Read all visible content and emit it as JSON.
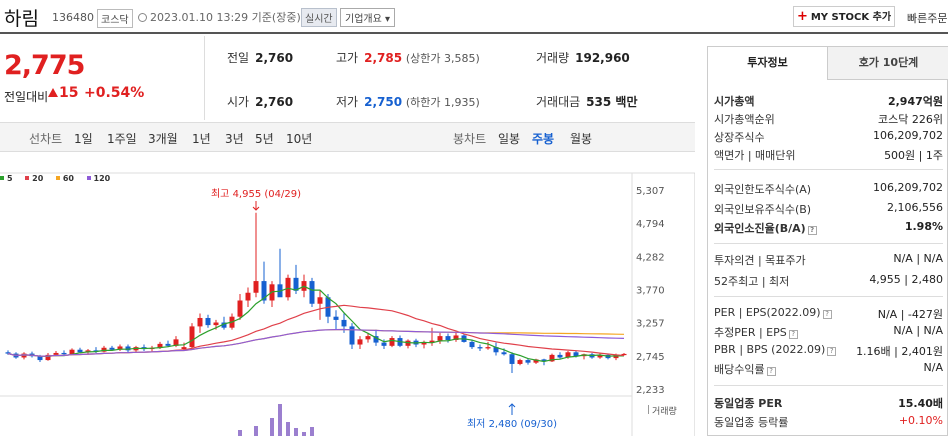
{
  "header": {
    "stock_name": "하림",
    "stock_code": "136480",
    "market": "코스닥",
    "datetime": "2023.01.10 13:29 기준(장중)",
    "realtime": "실시간",
    "overview": "기업개요 ▾",
    "mystock_label": "MY STOCK 추가",
    "quick_label": "빠른주문"
  },
  "price": {
    "current": "2,775",
    "compare_label": "전일대비",
    "change": "15",
    "change_pct": "+0.54%"
  },
  "stats": {
    "prev_close_label": "전일",
    "prev_close": "2,760",
    "high_label": "고가",
    "high": "2,785",
    "upper_limit": "(상한가 3,585)",
    "volume_label": "거래량",
    "volume": "192,960",
    "open_label": "시가",
    "open": "2,760",
    "low_label": "저가",
    "low": "2,750",
    "lower_limit": "(하한가 1,935)",
    "amount_label": "거래대금",
    "amount": "535 백만"
  },
  "period_bar": {
    "line_chart_label": "선차트",
    "periods": [
      "1일",
      "1주일",
      "3개월",
      "1년",
      "3년",
      "5년",
      "10년"
    ],
    "candle_label": "봉차트",
    "candles": [
      "일봉",
      "주봉",
      "월봉"
    ],
    "selected_candle": "주봉"
  },
  "chart_data": {
    "type": "candlestick",
    "moving_averages": [
      {
        "name": "5",
        "color": "#2ca02c"
      },
      {
        "name": "20",
        "color": "#e0404a"
      },
      {
        "name": "60",
        "color": "#f5a623"
      },
      {
        "name": "120",
        "color": "#8e5bd8"
      }
    ],
    "y_ticks": [
      "5,307",
      "4,794",
      "4,282",
      "3,770",
      "3,257",
      "2,745",
      "2,233"
    ],
    "ylim": [
      2233,
      5307
    ],
    "high_annotation": "최고 4,955 (04/29)",
    "low_annotation": "최저 2,480 (09/30)",
    "volume_label": "거래량",
    "colors": {
      "up": "#e02020",
      "down": "#1660d0"
    },
    "candles": [
      [
        2800,
        2830,
        2760,
        2780
      ],
      [
        2780,
        2800,
        2700,
        2720
      ],
      [
        2720,
        2800,
        2690,
        2780
      ],
      [
        2780,
        2810,
        2720,
        2740
      ],
      [
        2740,
        2760,
        2650,
        2680
      ],
      [
        2680,
        2790,
        2670,
        2760
      ],
      [
        2760,
        2820,
        2740,
        2790
      ],
      [
        2790,
        2830,
        2760,
        2770
      ],
      [
        2770,
        2860,
        2760,
        2840
      ],
      [
        2840,
        2870,
        2790,
        2800
      ],
      [
        2800,
        2850,
        2760,
        2830
      ],
      [
        2830,
        2880,
        2790,
        2810
      ],
      [
        2810,
        2900,
        2800,
        2870
      ],
      [
        2870,
        2900,
        2820,
        2840
      ],
      [
        2840,
        2920,
        2820,
        2890
      ],
      [
        2890,
        2920,
        2800,
        2830
      ],
      [
        2830,
        2900,
        2790,
        2880
      ],
      [
        2880,
        2920,
        2820,
        2850
      ],
      [
        2850,
        2900,
        2800,
        2870
      ],
      [
        2870,
        2960,
        2850,
        2930
      ],
      [
        2930,
        2980,
        2880,
        2900
      ],
      [
        2900,
        3050,
        2880,
        3000
      ],
      [
        2850,
        2950,
        2820,
        2880
      ],
      [
        2880,
        3250,
        2850,
        3200
      ],
      [
        3200,
        3400,
        3100,
        3330
      ],
      [
        3330,
        3380,
        3180,
        3220
      ],
      [
        3220,
        3300,
        3150,
        3260
      ],
      [
        3260,
        3350,
        3150,
        3180
      ],
      [
        3180,
        3400,
        3150,
        3350
      ],
      [
        3350,
        3700,
        3300,
        3600
      ],
      [
        3600,
        3800,
        3500,
        3720
      ],
      [
        3720,
        4955,
        3650,
        3900
      ],
      [
        3900,
        4200,
        3550,
        3600
      ],
      [
        3600,
        3900,
        3500,
        3850
      ],
      [
        3850,
        4400,
        3700,
        3650
      ],
      [
        3650,
        4000,
        3600,
        3950
      ],
      [
        3950,
        4150,
        3700,
        3750
      ],
      [
        3750,
        4000,
        3650,
        3900
      ],
      [
        3900,
        3950,
        3500,
        3550
      ],
      [
        3550,
        3750,
        3300,
        3650
      ],
      [
        3650,
        3700,
        3250,
        3350
      ],
      [
        3350,
        3450,
        3150,
        3300
      ],
      [
        3300,
        3400,
        3100,
        3200
      ],
      [
        3200,
        3250,
        2850,
        2920
      ],
      [
        2920,
        3050,
        2850,
        3000
      ],
      [
        3000,
        3100,
        2950,
        3050
      ],
      [
        3050,
        3150,
        2900,
        2950
      ],
      [
        2950,
        3000,
        2850,
        2900
      ],
      [
        2900,
        3050,
        2880,
        3020
      ],
      [
        3020,
        3060,
        2880,
        2900
      ],
      [
        2900,
        3000,
        2860,
        2980
      ],
      [
        2980,
        3010,
        2880,
        2920
      ],
      [
        2920,
        2980,
        2860,
        2950
      ],
      [
        2950,
        3180,
        2900,
        2980
      ],
      [
        2980,
        3100,
        2930,
        3050
      ],
      [
        3050,
        3090,
        2950,
        2990
      ],
      [
        2990,
        3100,
        2960,
        3060
      ],
      [
        3060,
        3080,
        2950,
        2960
      ],
      [
        2960,
        2990,
        2850,
        2880
      ],
      [
        2880,
        2920,
        2820,
        2860
      ],
      [
        2860,
        2960,
        2840,
        2880
      ],
      [
        2880,
        2950,
        2750,
        2800
      ],
      [
        2800,
        2860,
        2750,
        2770
      ],
      [
        2770,
        2800,
        2480,
        2620
      ],
      [
        2620,
        2700,
        2600,
        2680
      ],
      [
        2680,
        2700,
        2610,
        2640
      ],
      [
        2640,
        2700,
        2620,
        2690
      ],
      [
        2690,
        2700,
        2600,
        2660
      ],
      [
        2660,
        2780,
        2650,
        2760
      ],
      [
        2760,
        2800,
        2700,
        2720
      ],
      [
        2720,
        2820,
        2700,
        2800
      ],
      [
        2800,
        2820,
        2720,
        2740
      ],
      [
        2740,
        2780,
        2690,
        2770
      ],
      [
        2770,
        2790,
        2700,
        2720
      ],
      [
        2720,
        2790,
        2700,
        2760
      ],
      [
        2760,
        2780,
        2690,
        2710
      ],
      [
        2710,
        2780,
        2680,
        2760
      ],
      [
        2760,
        2790,
        2750,
        2775
      ]
    ]
  },
  "info_panel": {
    "tab_invest": "투자정보",
    "tab_quote": "호가 10단계",
    "market_cap_label": "시가총액",
    "market_cap": "2,947억원",
    "market_cap_rank_label": "시가총액순위",
    "market_cap_rank": "코스닥 226위",
    "shares_label": "상장주식수",
    "shares": "106,209,702",
    "par_label": "액면가 | 매매단위",
    "par": "500원 | 1주",
    "foreign_limit_label": "외국인한도주식수(A)",
    "foreign_limit": "106,209,702",
    "foreign_hold_label": "외국인보유주식수(B)",
    "foreign_hold": "2,106,556",
    "foreign_ratio_label": "외국인소진율(B/A)",
    "foreign_ratio": "1.98%",
    "opinion_label": "투자의견 | 목표주가",
    "opinion": "N/A | N/A",
    "range52_label": "52주최고 | 최저",
    "range52": "4,955 | 2,480",
    "per_label": "PER | EPS(2022.09)",
    "per": "N/A | -427원",
    "est_per_label": "추정PER | EPS",
    "est_per": "N/A | N/A",
    "pbr_label": "PBR | BPS (2022.09)",
    "pbr": "1.16배 | 2,401원",
    "dividend_label": "배당수익률",
    "dividend": "N/A",
    "sector_per_label": "동일업종 PER",
    "sector_per": "15.40배",
    "sector_rate_label": "동일업종 등락률",
    "sector_rate": "+0.10%"
  }
}
